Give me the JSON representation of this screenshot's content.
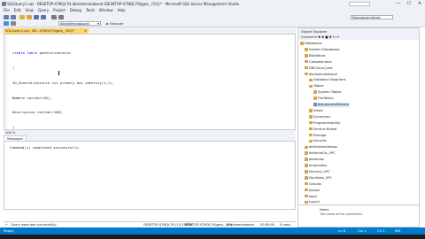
{
  "window": {
    "title": "SQLQuery1.sql - DESKTOP-47NQL7H.dbsistemalaboral (DESKTOP-47NQL7H\\jgeo_ (55))* - Microsoft SQL Server Management Studio",
    "quick_launch_placeholder": "",
    "minimize": "—",
    "maximize": "☐",
    "close": "✕"
  },
  "menu": [
    "File",
    "Edit",
    "View",
    "Query",
    "Project",
    "Debug",
    "Tools",
    "Window",
    "Help"
  ],
  "toolbar": {
    "database": "dbsistemalaboral",
    "execute": "Execute",
    "object_dropdown": "Nuevoprocedure"
  },
  "editor": {
    "tab_label": "SQLQuery1.sql - DE...47NQL7H\\jgeo_ (55))*",
    "tab_close": "✕",
    "lines": [
      {
        "kw": "create table ",
        "rest": "generolitorario"
      },
      {
        "kw": "",
        "rest": "("
      },
      {
        "kw": "",
        "rest": "ID_GeneroLiterario int primary key identity(1,1),"
      },
      {
        "kw": "",
        "rest": "Nombre varchar(50),"
      },
      {
        "kw": "",
        "rest": "Descripcion varchar(100)"
      },
      {
        "kw": "",
        "rest": ")"
      }
    ],
    "zoom": "100 %"
  },
  "results": {
    "tab": "Messages",
    "message": "Command(s) completed successfully."
  },
  "query_status": {
    "text": "Query executed successfully.",
    "server": "DESKTOP-47NQL7H (13.0 RTM)",
    "user": "DESKTOP-47NQL7H\\jgeo_ (55)",
    "db": "dbsistemalaboral",
    "time": "00:00:00",
    "rows": "0 rows"
  },
  "object_explorer": {
    "title": "Object Explorer",
    "tools": "Connect ▾  ✱ ✱ ■ ▼ ↻ ⟲",
    "tree": [
      {
        "label": "Databases",
        "indent": 0,
        "icon": "#d9a441"
      },
      {
        "label": "System Databases",
        "indent": 1,
        "icon": "#d9a441"
      },
      {
        "label": "BDeditora",
        "indent": 1,
        "icon": "#c9a35a"
      },
      {
        "label": "Campeonatos",
        "indent": 1,
        "icon": "#c9a35a"
      },
      {
        "label": "DBClinica_test",
        "indent": 1,
        "icon": "#c9a35a"
      },
      {
        "label": "dbsistemalaboral",
        "indent": 1,
        "icon": "#c9a35a"
      },
      {
        "label": "Database Diagrams",
        "indent": 2,
        "icon": "#d9a441"
      },
      {
        "label": "Tables",
        "indent": 2,
        "icon": "#d9a441"
      },
      {
        "label": "System Tables",
        "indent": 3,
        "icon": "#d9a441"
      },
      {
        "label": "FileTables",
        "indent": 3,
        "icon": "#d9a441"
      },
      {
        "label": "dbo.generolitorario",
        "indent": 3,
        "icon": "#6b8cc7",
        "selected": true
      },
      {
        "label": "Views",
        "indent": 2,
        "icon": "#d9a441"
      },
      {
        "label": "Synonyms",
        "indent": 2,
        "icon": "#d9a441"
      },
      {
        "label": "Programmability",
        "indent": 2,
        "icon": "#d9a441"
      },
      {
        "label": "Service Broker",
        "indent": 2,
        "icon": "#d9a441"
      },
      {
        "label": "Storage",
        "indent": 2,
        "icon": "#d9a441"
      },
      {
        "label": "Security",
        "indent": 2,
        "icon": "#d9a441"
      },
      {
        "label": "dbSistemaVentas",
        "indent": 1,
        "icon": "#c9a35a"
      },
      {
        "label": "dbVentaSis_VPC",
        "indent": 1,
        "icon": "#c9a35a"
      },
      {
        "label": "dbventas",
        "indent": 1,
        "icon": "#c9a35a"
      },
      {
        "label": "empleados",
        "indent": 1,
        "icon": "#c9a35a"
      },
      {
        "label": "Farmica_VPC",
        "indent": 1,
        "icon": "#c9a35a"
      },
      {
        "label": "Facultata_VPC",
        "indent": 1,
        "icon": "#c9a35a"
      },
      {
        "label": "Gracias",
        "indent": 1,
        "icon": "#c9a35a"
      },
      {
        "label": "josaph",
        "indent": 1,
        "icon": "#c9a35a"
      },
      {
        "label": "login",
        "indent": 1,
        "icon": "#c9a35a"
      },
      {
        "label": "Login1",
        "indent": 1,
        "icon": "#c9a35a"
      },
      {
        "label": "NF",
        "indent": 1,
        "icon": "#c9a35a"
      },
      {
        "label": "pais",
        "indent": 1,
        "icon": "#c9a35a"
      }
    ]
  },
  "properties": {
    "name": "Name",
    "desc": "The name of the connection."
  },
  "statusbar": {
    "left": "Ready",
    "ln": "Ln 8",
    "col": "Col 1",
    "ch": "Ch 1",
    "ins": "INS"
  },
  "colors": {
    "accent": "#007acc",
    "tab_active": "#ffd767",
    "keyword": "#0000ff"
  }
}
